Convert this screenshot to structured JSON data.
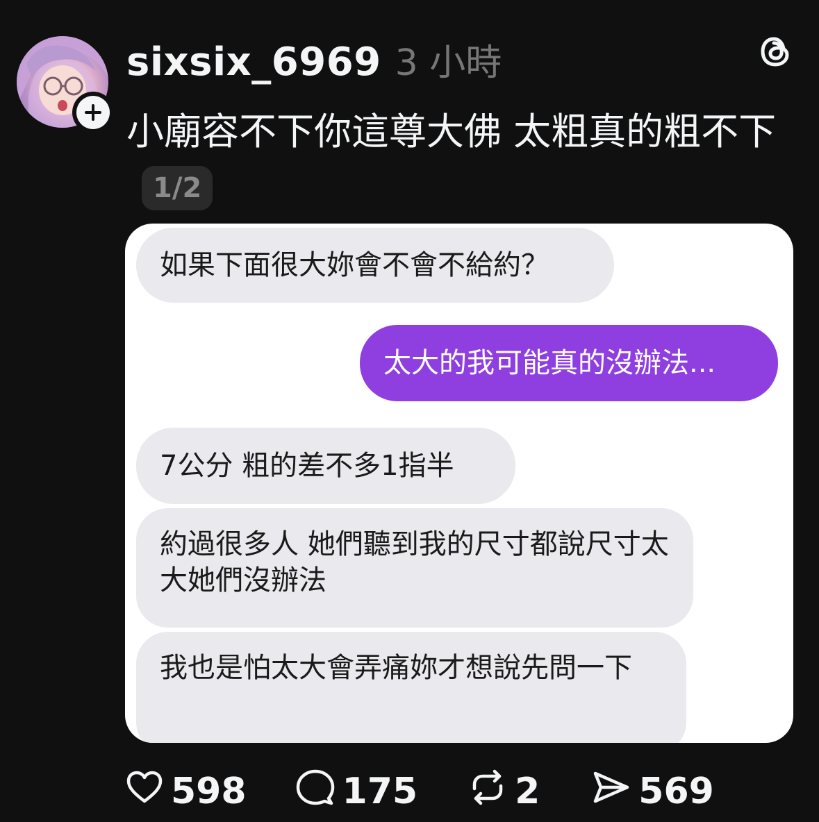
{
  "post": {
    "username": "sixsix_6969",
    "time": "3 小時",
    "text": "小廟容不下你這尊大佛 太粗真的粗不下",
    "page_indicator": "1/2"
  },
  "chat": {
    "messages": [
      {
        "direction": "incoming",
        "text": "如果下面很大妳會不會不給約？"
      },
      {
        "direction": "outgoing",
        "text": "太大的我可能真的沒辦法..."
      },
      {
        "direction": "incoming",
        "text": "7公分 粗的差不多1指半"
      },
      {
        "direction": "incoming",
        "text": "約過很多人 她們聽到我的尺寸都說尺寸太大她們沒辦法"
      },
      {
        "direction": "incoming",
        "text": "我也是怕太大會弄痛妳才想說先問一下"
      }
    ]
  },
  "actions": {
    "likes": "598",
    "comments": "175",
    "reposts": "2",
    "shares": "569"
  },
  "icons": {
    "avatar": "avatar",
    "follow": "plus-icon",
    "app_logo": "threads-logo-icon",
    "like": "heart-icon",
    "comment": "comment-bubble-icon",
    "repost": "repost-icon",
    "share": "send-icon"
  },
  "colors": {
    "background": "#101010",
    "outgoing_bubble": "#8f3ee0",
    "incoming_bubble": "#e9e9ee",
    "muted_text": "#777777"
  }
}
